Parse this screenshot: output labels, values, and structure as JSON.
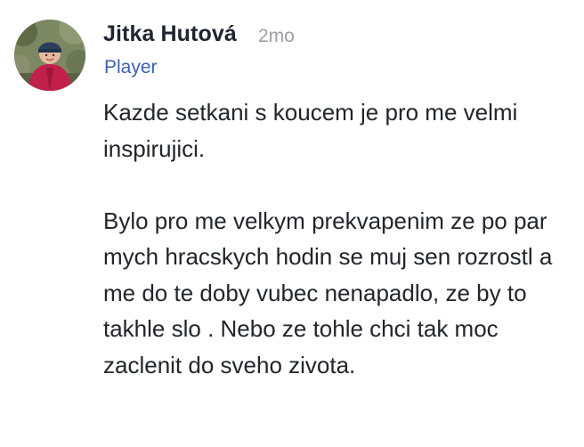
{
  "comment": {
    "author": {
      "name": "Jitka Hutová",
      "role": "Player",
      "avatar_icon": "user-photo-avatar"
    },
    "timestamp": "2mo",
    "paragraphs": [
      "Kazde setkani s koucem je pro me velmi inspirujici.",
      "Bylo pro me velkym prekvapenim ze po par mych hracskych hodin se muj sen rozrostl a me do te doby vubec nenapadlo, ze by to takhle slo . Nebo ze tohle chci tak moc zaclenit do sveho zivota."
    ]
  },
  "colors": {
    "name": "#1f2430",
    "role": "#3b5fb0",
    "timestamp": "#9a9ea6",
    "body_text": "#22252b"
  }
}
